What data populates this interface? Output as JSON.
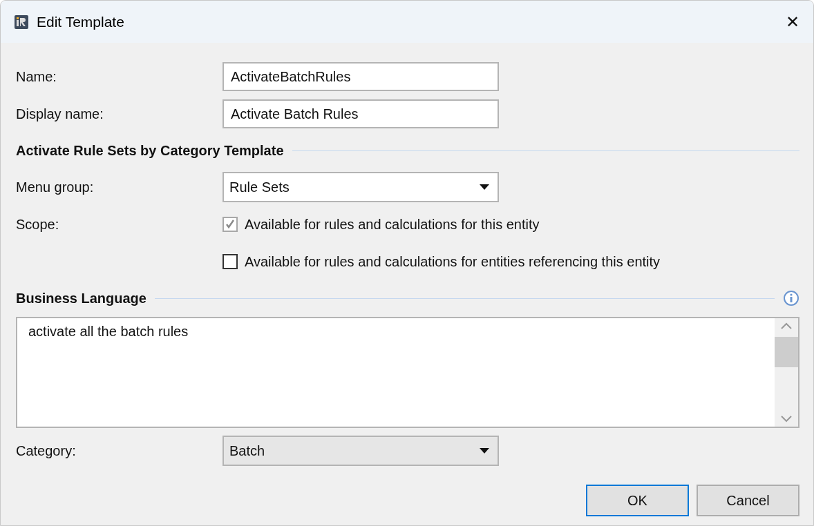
{
  "window": {
    "title": "Edit Template",
    "close": "✕"
  },
  "fields": [
    {
      "label": "Name:",
      "value": "ActivateBatchRules"
    },
    {
      "label": "Display name:",
      "value": "Activate Batch Rules"
    }
  ],
  "template_section": {
    "title": "Activate Rule Sets by Category Template",
    "menu_group": {
      "label": "Menu group:",
      "value": "Rule Sets"
    },
    "scope": {
      "label": "Scope:",
      "options": [
        {
          "text": "Available for rules and calculations for this entity",
          "checked": true,
          "disabled": true
        },
        {
          "text": "Available for rules and calculations for entities referencing this entity",
          "checked": false,
          "disabled": false
        }
      ]
    }
  },
  "business_language": {
    "title": "Business Language",
    "text": "activate all the batch rules"
  },
  "category": {
    "label": "Category:",
    "value": "Batch"
  },
  "buttons": [
    {
      "label": "OK",
      "default": true
    },
    {
      "label": "Cancel",
      "default": false
    }
  ]
}
